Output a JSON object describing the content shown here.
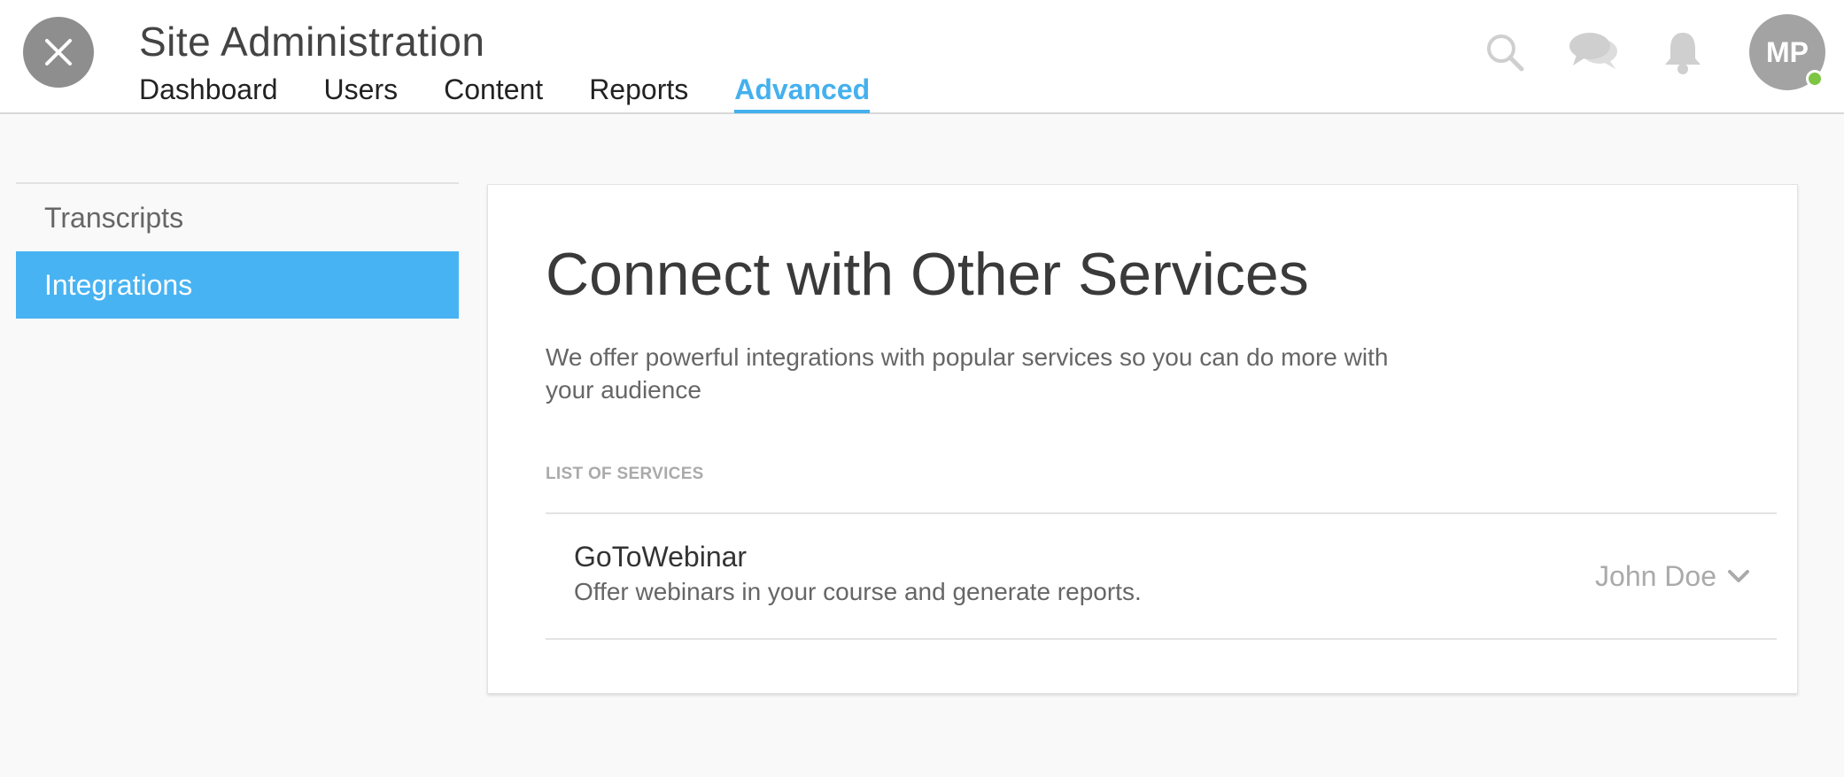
{
  "header": {
    "title": "Site Administration",
    "close_icon": "close-icon",
    "tabs": [
      {
        "label": "Dashboard",
        "active": false
      },
      {
        "label": "Users",
        "active": false
      },
      {
        "label": "Content",
        "active": false
      },
      {
        "label": "Reports",
        "active": false
      },
      {
        "label": "Advanced",
        "active": true
      }
    ],
    "icons": [
      "search-icon",
      "chat-icon",
      "bell-icon"
    ],
    "avatar_initials": "MP",
    "status_color": "#7ec544"
  },
  "sidebar": {
    "items": [
      {
        "label": "Transcripts",
        "active": false
      },
      {
        "label": "Integrations",
        "active": true
      }
    ]
  },
  "main": {
    "title": "Connect with Other Services",
    "description": "We offer powerful integrations with popular services so you can do more with your audience",
    "list_label": "LIST OF SERVICES",
    "services": [
      {
        "name": "GoToWebinar",
        "description": "Offer webinars in your course and generate reports.",
        "account": "John Doe"
      }
    ]
  },
  "colors": {
    "accent": "#45b0ee",
    "sidebar_active": "#48b3f2",
    "background": "#f9f9f9"
  }
}
